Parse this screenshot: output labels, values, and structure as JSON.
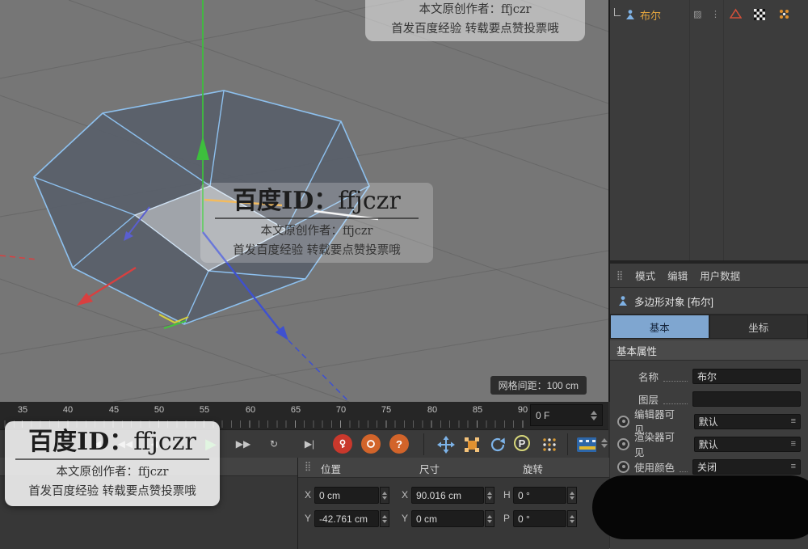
{
  "watermark": {
    "id_prefix": "百度ID：",
    "id_name": "ffjczr",
    "author_line": "本文原创作者：ffjczr",
    "promo_line": "首发百度经验 转载要点赞投票哦"
  },
  "viewport": {
    "grid_spacing_label": "网格间距：100 cm"
  },
  "timeline": {
    "ticks": [
      "35",
      "40",
      "45",
      "50",
      "55",
      "60",
      "65",
      "70",
      "75",
      "80",
      "85",
      "90"
    ],
    "frame_field_value": "0 F"
  },
  "icons": {
    "drag_handle": "⣿",
    "goto_start": "|◀",
    "previous_key": "◀◀",
    "previous_frame": "◀",
    "play": "▶",
    "next_frame": "▶▶",
    "loop": "↻",
    "goto_end": "▶|",
    "record_help": "?",
    "p_button": "P",
    "menu_lines": "≡",
    "texture_tag": "▨",
    "dots_small": "⋮"
  },
  "coordinates": {
    "position_header": "位置",
    "size_header": "尺寸",
    "rotation_header": "旋转",
    "rows": [
      {
        "pos_axis": "X",
        "pos_value": "0 cm",
        "size_axis": "X",
        "size_value": "90.016 cm",
        "rot_axis": "H",
        "rot_value": "0 °"
      },
      {
        "pos_axis": "Y",
        "pos_value": "-42.761 cm",
        "size_axis": "Y",
        "size_value": "0 cm",
        "rot_axis": "P",
        "rot_value": "0 °"
      }
    ]
  },
  "object_manager": {
    "item_label": "布尔"
  },
  "attributes": {
    "menu_mode": "模式",
    "menu_edit": "编辑",
    "menu_user_data": "用户数据",
    "object_title": "多边形对象 [布尔]",
    "tab_basic": "基本",
    "tab_coordinates": "坐标",
    "section_title": "基本属性",
    "name_label": "名称",
    "name_value": "布尔",
    "layer_label": "图层",
    "layer_value": "",
    "editor_visible_label": "编辑器可见",
    "editor_visible_value": "默认",
    "renderer_visible_label": "渲染器可见",
    "renderer_visible_value": "默认",
    "use_color_label": "使用颜色",
    "use_color_value": "关闭"
  }
}
